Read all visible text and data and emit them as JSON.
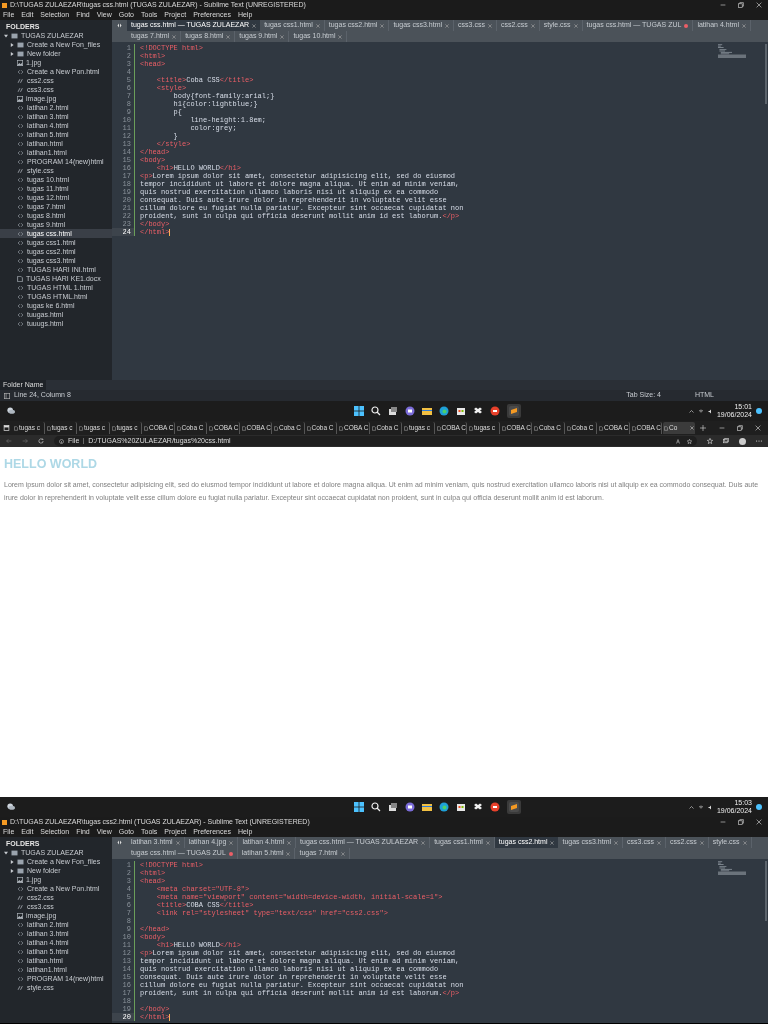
{
  "editor_top": {
    "title": "D:\\TUGAS ZULAEZAR\\tugas css.html (TUGAS ZULAEZAR) - Sublime Text (UNREGISTERED)",
    "menu": [
      "File",
      "Edit",
      "Selection",
      "Find",
      "View",
      "Goto",
      "Tools",
      "Project",
      "Preferences",
      "Help"
    ],
    "sidebar": {
      "heading": "FOLDERS",
      "tree": [
        {
          "label": "TUGAS ZULAEZAR",
          "kind": "folder",
          "expanded": true,
          "selected": false,
          "children": [
            {
              "label": "Create a New Fon_files",
              "kind": "folder",
              "expanded": false,
              "selected": false
            },
            {
              "label": "New folder",
              "kind": "folder",
              "expanded": false,
              "selected": false
            },
            {
              "label": "1.jpg",
              "kind": "image",
              "selected": false
            },
            {
              "label": "Create a New Pon.html",
              "kind": "html",
              "selected": false
            },
            {
              "label": "css2.css",
              "kind": "css",
              "selected": false
            },
            {
              "label": "css3.css",
              "kind": "css",
              "selected": false
            },
            {
              "label": "image.jpg",
              "kind": "image",
              "selected": false
            },
            {
              "label": "latihan 2.html",
              "kind": "html",
              "selected": false
            },
            {
              "label": "latihan 3.html",
              "kind": "html",
              "selected": false
            },
            {
              "label": "latihan 4.html",
              "kind": "html",
              "selected": false
            },
            {
              "label": "latihan 5.html",
              "kind": "html",
              "selected": false
            },
            {
              "label": "latihan.html",
              "kind": "html",
              "selected": false
            },
            {
              "label": "latihan1.html",
              "kind": "html",
              "selected": false
            },
            {
              "label": "PROGRAM 14(new)html",
              "kind": "html",
              "selected": false
            },
            {
              "label": "style.css",
              "kind": "css",
              "selected": false
            },
            {
              "label": "tugas 10.html",
              "kind": "html",
              "selected": false
            },
            {
              "label": "tugas 11.html",
              "kind": "html",
              "selected": false
            },
            {
              "label": "tugas 12.html",
              "kind": "html",
              "selected": false
            },
            {
              "label": "tugas 7.html",
              "kind": "html",
              "selected": false
            },
            {
              "label": "tugas 8.html",
              "kind": "html",
              "selected": false
            },
            {
              "label": "tugas 9.html",
              "kind": "html",
              "selected": false
            },
            {
              "label": "tugas css.html",
              "kind": "html",
              "selected": true
            },
            {
              "label": "tugas css1.html",
              "kind": "html",
              "selected": false
            },
            {
              "label": "tugas css2.html",
              "kind": "html",
              "selected": false
            },
            {
              "label": "tugas css3.html",
              "kind": "html",
              "selected": false
            },
            {
              "label": "TUGAS HARI INI.html",
              "kind": "html",
              "selected": false
            },
            {
              "label": "TUGAS HARI KE1.docx",
              "kind": "doc",
              "selected": false
            },
            {
              "label": "TUGAS HTML 1.html",
              "kind": "html",
              "selected": false
            },
            {
              "label": "TUGAS HTML.html",
              "kind": "html",
              "selected": false
            },
            {
              "label": "tugas ke 6.html",
              "kind": "html",
              "selected": false
            },
            {
              "label": "tuugas.html",
              "kind": "html",
              "selected": false
            },
            {
              "label": "tuuugs.html",
              "kind": "html",
              "selected": false
            }
          ]
        }
      ]
    },
    "tabs": [
      {
        "label": "tugas css.html — TUGAS ZULAEZAR",
        "selected": true,
        "modified": false
      },
      {
        "label": "tugas css1.html",
        "selected": false,
        "modified": false
      },
      {
        "label": "tugas css2.html",
        "selected": false,
        "modified": false
      },
      {
        "label": "tugas css3.html",
        "selected": false,
        "modified": false
      },
      {
        "label": "css3.css",
        "selected": false,
        "modified": false
      },
      {
        "label": "css2.css",
        "selected": false,
        "modified": false
      },
      {
        "label": "style.css",
        "selected": false,
        "modified": false
      },
      {
        "label": "tugas css.html — TUGAS ZUL",
        "selected": false,
        "modified": true
      },
      {
        "label": "latihan 4.html",
        "selected": false,
        "modified": false
      },
      {
        "label": "tugas 7.html",
        "selected": false,
        "modified": false
      },
      {
        "label": "tugas 8.html",
        "selected": false,
        "modified": false
      },
      {
        "label": "tugas 9.html",
        "selected": false,
        "modified": false
      },
      {
        "label": "tugas 10.html",
        "selected": false,
        "modified": false
      }
    ],
    "code": [
      {
        "n": "1",
        "text": "<!DOCTYPE html>",
        "selected": false
      },
      {
        "n": "2",
        "text": "<html>",
        "selected": false
      },
      {
        "n": "3",
        "text": "<head>",
        "selected": false
      },
      {
        "n": "4",
        "selected": false
      },
      {
        "n": "5",
        "text": "    <title>Coba CSS</title>",
        "selected": false
      },
      {
        "n": "6",
        "text": "    <style>",
        "selected": false
      },
      {
        "n": "7",
        "text": "        body{font-family:arial;}",
        "selected": false
      },
      {
        "n": "8",
        "text": "        h1{color:lightblue;}",
        "selected": false
      },
      {
        "n": "9",
        "text": "        p{",
        "selected": false
      },
      {
        "n": "10",
        "text": "            line-height:1.8em;",
        "selected": false
      },
      {
        "n": "11",
        "text": "            color:grey;",
        "selected": false
      },
      {
        "n": "12",
        "text": "        }",
        "selected": false
      },
      {
        "n": "13",
        "text": "    </style>",
        "selected": false
      },
      {
        "n": "14",
        "text": "</head>",
        "selected": false
      },
      {
        "n": "15",
        "text": "<body>",
        "selected": false
      },
      {
        "n": "16",
        "text": "    <h1>HELLO WORLD</h1>",
        "selected": false
      },
      {
        "n": "17",
        "text": "<p>Lorem ipsum dolor sit amet, consectetur adipisicing elit, sed do eiusmod",
        "selected": false
      },
      {
        "n": "18",
        "text": "tempor incididunt ut labore et dolore magna aliqua. Ut enim ad minim veniam,",
        "selected": false
      },
      {
        "n": "19",
        "text": "quis nostrud exercitation ullamco laboris nisi ut aliquip ex ea commodo",
        "selected": false
      },
      {
        "n": "20",
        "text": "consequat. Duis aute irure dolor in reprehenderit in voluptate velit esse",
        "selected": false
      },
      {
        "n": "21",
        "text": "cillum dolore eu fugiat nulla pariatur. Excepteur sint occaecat cupidatat non",
        "selected": false
      },
      {
        "n": "22",
        "text": "proident, sunt in culpa qui officia deserunt mollit anim id est laborum.</p>",
        "selected": false
      },
      {
        "n": "23",
        "text": "</body>",
        "selected": false
      },
      {
        "n": "24",
        "text": "</html>",
        "selected": true
      }
    ],
    "folder_name_label": "Folder Name",
    "status": {
      "position": "Line 24, Column 8",
      "tab_size": "Tab Size: 4",
      "syntax": "HTML"
    }
  },
  "taskbar_top": {
    "time": "15:01",
    "date": "19/06/2024"
  },
  "browser": {
    "tabs": [
      {
        "label": "tugas c",
        "selected": false
      },
      {
        "label": "tugas c",
        "selected": false
      },
      {
        "label": "tugas c",
        "selected": false
      },
      {
        "label": "tugas c",
        "selected": false
      },
      {
        "label": "COBA C",
        "selected": false
      },
      {
        "label": "Coba C",
        "selected": false
      },
      {
        "label": "COBA C",
        "selected": false
      },
      {
        "label": "COBA C",
        "selected": false
      },
      {
        "label": "Coba C",
        "selected": false
      },
      {
        "label": "Coba C",
        "selected": false
      },
      {
        "label": "COBA C",
        "selected": false
      },
      {
        "label": "Coba C",
        "selected": false
      },
      {
        "label": "tugas c",
        "selected": false
      },
      {
        "label": "COBA C",
        "selected": false
      },
      {
        "label": "tugas c",
        "selected": false
      },
      {
        "label": "COBA C",
        "selected": false
      },
      {
        "label": "Coba C",
        "selected": false
      },
      {
        "label": "Coba C",
        "selected": false
      },
      {
        "label": "COBA C",
        "selected": false
      },
      {
        "label": "COBA C",
        "selected": false
      },
      {
        "label": "Co",
        "selected": true
      }
    ],
    "file_label": "File",
    "url": "D:/TUGAS%20ZULAEZAR/tugas%20css.html",
    "page": {
      "heading": "HELLO WORLD",
      "paragraph": "Lorem ipsum dolor sit amet, consectetur adipisicing elit, sed do eiusmod tempor incididunt ut labore et dolore magna aliqua. Ut enim ad minim veniam, quis nostrud exercitation ullamco laboris nisi ut aliquip ex ea commodo consequat. Duis aute irure dolor in reprehenderit in voluptate velit esse cillum dolore eu fugiat nulla pariatur. Excepteur sint occaecat cupidatat non proident, sunt in culpa qui officia deserunt mollit anim id est laborum."
    }
  },
  "taskbar_bottom": {
    "time": "15:03",
    "date": "19/06/2024"
  },
  "editor_bottom": {
    "title": "D:\\TUGAS ZULAEZAR\\tugas css2.html (TUGAS ZULAEZAR) - Sublime Text (UNREGISTERED)",
    "menu": [
      "File",
      "Edit",
      "Selection",
      "Find",
      "View",
      "Goto",
      "Tools",
      "Project",
      "Preferences",
      "Help"
    ],
    "sidebar": {
      "heading": "FOLDERS",
      "tree": [
        {
          "label": "TUGAS ZULAEZAR",
          "kind": "folder",
          "expanded": true,
          "selected": false,
          "children": [
            {
              "label": "Create a New Fon_files",
              "kind": "folder",
              "expanded": false,
              "selected": false
            },
            {
              "label": "New folder",
              "kind": "folder",
              "expanded": false,
              "selected": false
            },
            {
              "label": "1.jpg",
              "kind": "image",
              "selected": false
            },
            {
              "label": "Create a New Pon.html",
              "kind": "html",
              "selected": false
            },
            {
              "label": "css2.css",
              "kind": "css",
              "selected": false
            },
            {
              "label": "css3.css",
              "kind": "css",
              "selected": false
            },
            {
              "label": "image.jpg",
              "kind": "image",
              "selected": false
            },
            {
              "label": "latihan 2.html",
              "kind": "html",
              "selected": false
            },
            {
              "label": "latihan 3.html",
              "kind": "html",
              "selected": false
            },
            {
              "label": "latihan 4.html",
              "kind": "html",
              "selected": false
            },
            {
              "label": "latihan 5.html",
              "kind": "html",
              "selected": false
            },
            {
              "label": "latihan.html",
              "kind": "html",
              "selected": false
            },
            {
              "label": "latihan1.html",
              "kind": "html",
              "selected": false
            },
            {
              "label": "PROGRAM 14(new)html",
              "kind": "html",
              "selected": false
            },
            {
              "label": "style.css",
              "kind": "css",
              "selected": false
            }
          ]
        }
      ]
    },
    "tabs": [
      {
        "label": "latihan 3.html",
        "selected": false,
        "modified": false
      },
      {
        "label": "latihan 4.jpg",
        "selected": false,
        "modified": false
      },
      {
        "label": "latihan 4.html",
        "selected": false,
        "modified": false
      },
      {
        "label": "tugas css.html — TUGAS ZULAEZAR",
        "selected": false,
        "modified": false
      },
      {
        "label": "tugas css1.html",
        "selected": false,
        "modified": false
      },
      {
        "label": "tugas css2.html",
        "selected": true,
        "modified": false
      },
      {
        "label": "tugas css3.html",
        "selected": false,
        "modified": false
      },
      {
        "label": "css3.css",
        "selected": false,
        "modified": false
      },
      {
        "label": "css2.css",
        "selected": false,
        "modified": false
      },
      {
        "label": "style.css",
        "selected": false,
        "modified": false
      },
      {
        "label": "tugas css.html — TUGAS ZUL",
        "selected": false,
        "modified": true
      },
      {
        "label": "latihan 5.html",
        "selected": false,
        "modified": false
      },
      {
        "label": "tugas 7.html",
        "selected": false,
        "modified": false
      }
    ],
    "code": [
      {
        "n": "1",
        "text": "<!DOCTYPE html>",
        "selected": false
      },
      {
        "n": "2",
        "text": "<html>",
        "selected": false
      },
      {
        "n": "3",
        "text": "<head>",
        "selected": false
      },
      {
        "n": "4",
        "text": "    <meta charset=\"UTF-8\">",
        "selected": false
      },
      {
        "n": "5",
        "text": "    <meta name=\"viewport\" content=\"width=device-width, initial-scale=1\">",
        "selected": false
      },
      {
        "n": "6",
        "text": "    <title>COBA CSS</title>",
        "selected": false
      },
      {
        "n": "7",
        "text": "    <link rel=\"stylesheet\" type=\"text/css\" href=\"css2.css\">",
        "selected": false
      },
      {
        "n": "8",
        "selected": false
      },
      {
        "n": "9",
        "text": "</head>",
        "selected": false
      },
      {
        "n": "10",
        "text": "<body>",
        "selected": false
      },
      {
        "n": "11",
        "text": "    <h1>HELLO WORLD</h1>",
        "selected": false
      },
      {
        "n": "12",
        "text": "<p>Lorem ipsum dolor sit amet, consectetur adipisicing elit, sed do eiusmod",
        "selected": false
      },
      {
        "n": "13",
        "text": "tempor incididunt ut labore et dolore magna aliqua. Ut enim ad minim veniam,",
        "selected": false
      },
      {
        "n": "14",
        "text": "quis nostrud exercitation ullamco laboris nisi ut aliquip ex ea commodo",
        "selected": false
      },
      {
        "n": "15",
        "text": "consequat. Duis aute irure dolor in reprehenderit in voluptate velit esse",
        "selected": false
      },
      {
        "n": "16",
        "text": "cillum dolore eu fugiat nulla pariatur. Excepteur sint occaecat cupidatat non",
        "selected": false
      },
      {
        "n": "17",
        "text": "proident, sunt in culpa qui officia deserunt mollit anim id est laborum.</p>",
        "selected": false
      },
      {
        "n": "18",
        "selected": false
      },
      {
        "n": "19",
        "text": "</body>",
        "selected": false
      },
      {
        "n": "20",
        "text": "</html>",
        "selected": true
      }
    ]
  }
}
